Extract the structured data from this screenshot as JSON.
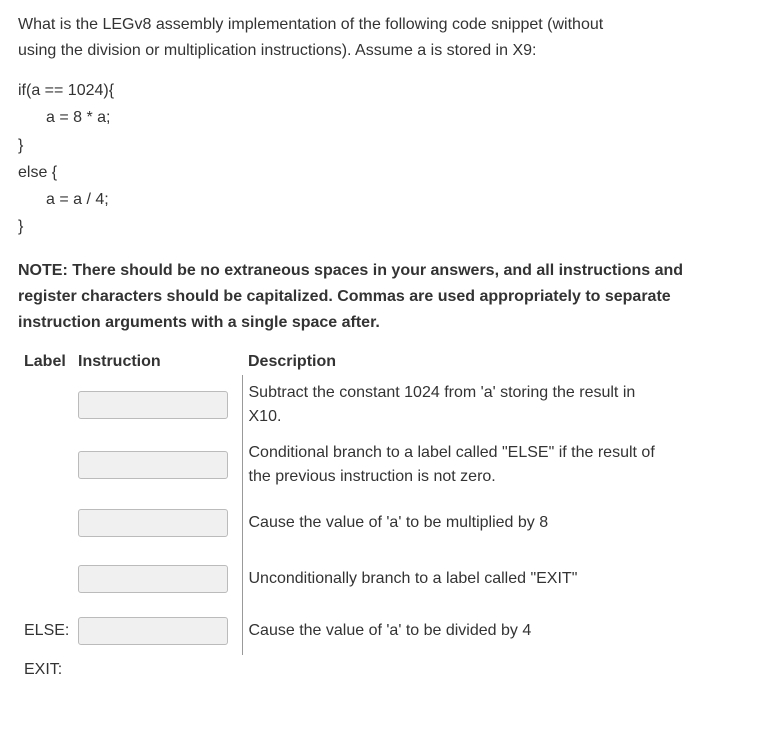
{
  "question": {
    "line1": "What is the LEGv8 assembly implementation of the following code snippet (without",
    "line2": "using the division or multiplication instructions).  Assume a is stored in X9:"
  },
  "code": {
    "l1": "if(a == 1024){",
    "l2": "a = 8 * a;",
    "l3": "}",
    "l4": "else {",
    "l5": "a = a / 4;",
    "l6": "}"
  },
  "note": {
    "l1": "NOTE: There should be no extraneous spaces in your answers, and all instructions and",
    "l2": "register characters should be capitalized.  Commas are used appropriately to separate",
    "l3": "instruction arguments with a single space after."
  },
  "table": {
    "header_label": "Label",
    "header_instruction": "Instruction",
    "header_description": "Description",
    "rows": [
      {
        "label": "",
        "desc1": "Subtract the constant 1024 from 'a' storing the result in",
        "desc2": "X10."
      },
      {
        "label": "",
        "desc1": "Conditional branch to a label called \"ELSE\" if the result of",
        "desc2": "the previous instruction is not zero."
      },
      {
        "label": "",
        "desc1": "Cause the value of 'a' to be multiplied by 8",
        "desc2": ""
      },
      {
        "label": "",
        "desc1": "Unconditionally branch to a label called \"EXIT\"",
        "desc2": ""
      },
      {
        "label": "ELSE:",
        "desc1": "Cause the value of 'a' to be divided by 4",
        "desc2": ""
      },
      {
        "label": "EXIT:",
        "desc1": "",
        "desc2": ""
      }
    ]
  }
}
